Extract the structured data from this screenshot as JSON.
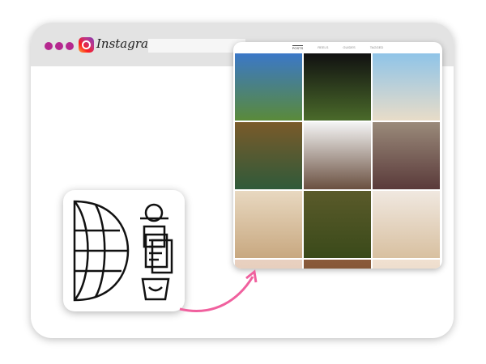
{
  "browser": {
    "brand": "Instagram",
    "dots": [
      "#b5288f",
      "#b5288f",
      "#b5288f"
    ]
  },
  "profile": {
    "tabs": [
      {
        "label": "POSTS",
        "active": true
      },
      {
        "label": "REELS"
      },
      {
        "label": "GUIDES"
      },
      {
        "label": "TAGGED"
      }
    ],
    "posts": [
      {
        "colors": [
          "#3b78c8",
          "#5a8a3a"
        ]
      },
      {
        "colors": [
          "#111",
          "#4a6a2a"
        ]
      },
      {
        "colors": [
          "#8fc4e8",
          "#e8dcc8"
        ]
      },
      {
        "colors": [
          "#7a5a2a",
          "#2f5a3a"
        ]
      },
      {
        "colors": [
          "#f4f4f4",
          "#6a5040"
        ]
      },
      {
        "colors": [
          "#9a8a7a",
          "#5a3a3a"
        ]
      },
      {
        "colors": [
          "#e8d8c0",
          "#c8a880"
        ]
      },
      {
        "colors": [
          "#5a5a2a",
          "#3a4a1a"
        ]
      },
      {
        "colors": [
          "#f0e8e0",
          "#d8c0a0"
        ]
      },
      {
        "colors": [
          "#e8d0c0",
          "#e0c8b0"
        ]
      },
      {
        "colors": [
          "#8a5a3a",
          "#6a4a2a"
        ]
      },
      {
        "colors": [
          "#f0e0d0",
          "#e0d0c0"
        ]
      }
    ]
  },
  "accent": "#f0609e"
}
